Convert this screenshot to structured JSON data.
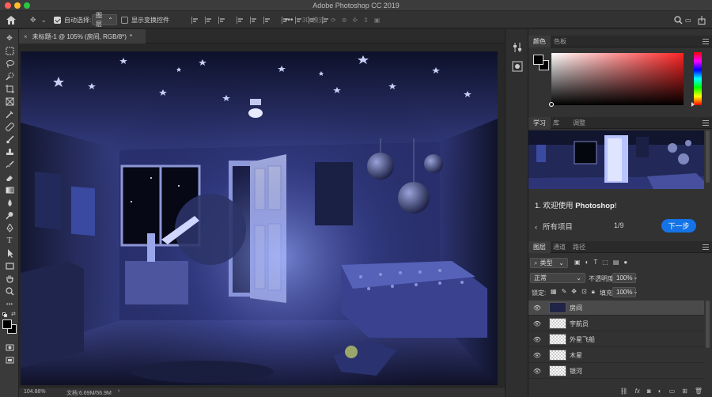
{
  "app": {
    "title": "Adobe Photoshop CC 2019"
  },
  "options_bar": {
    "auto_select_label": "自动选择:",
    "auto_select_target": "图层",
    "show_transform_label": "显示变换控件",
    "mode_3d_label": "3D 模式:"
  },
  "document": {
    "tab_title": "未标题-1 @ 105% (房间, RGB/8*)",
    "tab_modified": "*",
    "zoom": "104.88%",
    "doc_size": "文档:6.69M/56.9M"
  },
  "color_panel": {
    "tabs": [
      "颜色",
      "色板"
    ],
    "foreground": "#000000",
    "background": "#000000",
    "hue_base": "#ff2323"
  },
  "learn_panel": {
    "tabs": [
      "学习",
      "库",
      "调整"
    ],
    "step_title_prefix": "1. 欢迎使用 ",
    "step_title_bold": "Photoshop",
    "step_title_suffix": "!",
    "back_label": "所有项目",
    "progress": "1/9",
    "next_label": "下一步",
    "accent_color": "#1473e6"
  },
  "layers_panel": {
    "tabs": [
      "图层",
      "通道",
      "路径"
    ],
    "filter_kind": "类型",
    "blend_mode": "正常",
    "opacity_label": "不透明度:",
    "opacity_value": "100%",
    "lock_label": "锁定:",
    "fill_label": "填充:",
    "fill_value": "100%",
    "layers": [
      {
        "name": "房间",
        "selected": true,
        "thumb": "photo"
      },
      {
        "name": "宇航员",
        "selected": false,
        "thumb": "transparent"
      },
      {
        "name": "外星飞船",
        "selected": false,
        "thumb": "transparent"
      },
      {
        "name": "木星",
        "selected": false,
        "thumb": "transparent"
      },
      {
        "name": "银河",
        "selected": false,
        "thumb": "transparent"
      }
    ]
  }
}
